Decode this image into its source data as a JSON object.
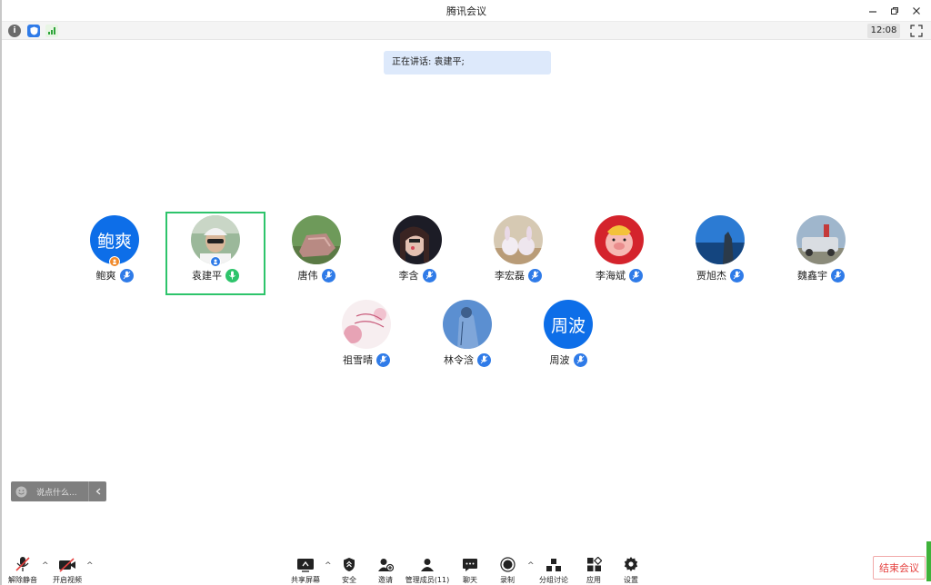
{
  "window": {
    "title": "腾讯会议"
  },
  "infobar": {
    "clock": "12:08"
  },
  "speaking": {
    "text": "正在讲话: 袁建平;"
  },
  "participants": [
    {
      "name": "鲍爽",
      "avatar_text": "鲍爽"
    },
    {
      "name": "袁建平"
    },
    {
      "name": "唐伟"
    },
    {
      "name": "李含"
    },
    {
      "name": "李宏磊"
    },
    {
      "name": "李海斌"
    },
    {
      "name": "贾旭杰"
    },
    {
      "name": "魏鑫宇"
    },
    {
      "name": "祖雪晴"
    },
    {
      "name": "林令浛"
    },
    {
      "name": "周波",
      "avatar_text": "周波"
    }
  ],
  "chat": {
    "placeholder": "说点什么..."
  },
  "toolbar": {
    "unmute": "解除静音",
    "start_video": "开启视频",
    "share_screen": "共享屏幕",
    "security": "安全",
    "invite": "邀请",
    "manage_members": "管理成员(11)",
    "chat": "聊天",
    "record": "录制",
    "breakout": "分组讨论",
    "apps": "应用",
    "settings": "设置",
    "end_meeting": "结束会议"
  },
  "colors": {
    "accent": "#0d6ee8",
    "speaking_border": "#2ec46b",
    "end_red": "#e5403e"
  }
}
